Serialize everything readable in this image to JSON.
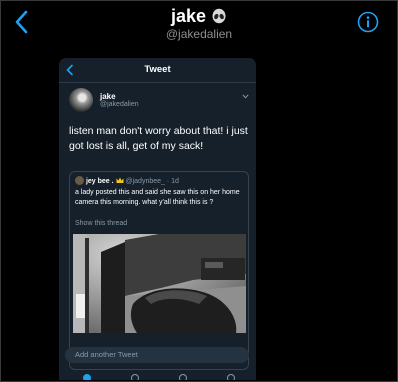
{
  "header": {
    "title": "jake",
    "handle": "@jakedalien",
    "back_icon": "chevron-left-icon",
    "info_icon": "info-icon",
    "emoji_icon": "alien-icon",
    "accent": "#1da1f2"
  },
  "screenshot": {
    "nav_title": "Tweet",
    "tweet": {
      "author": "jake",
      "handle": "@jakedalien",
      "text": "listen man don't worry about that! i just got lost is all, get of my sack!"
    },
    "quote": {
      "author": "jey bee .",
      "meta": "@jadynbee_ · 1d",
      "text": "a lady posted this and said she saw this on her home camera this morning. what y'all think this is ?",
      "link": "Show this thread"
    },
    "reply_placeholder": "Add another Tweet",
    "background": "#15202b"
  }
}
